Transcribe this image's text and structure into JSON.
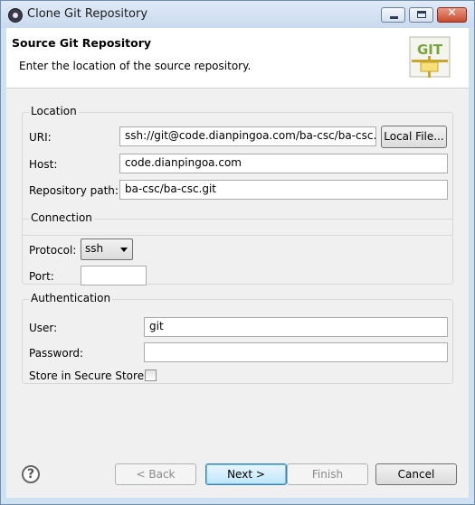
{
  "window": {
    "title": "Clone Git Repository",
    "controls": {
      "minimize": "minimize",
      "maximize": "maximize",
      "close": "close"
    }
  },
  "header": {
    "title": "Source Git Repository",
    "description": "Enter the location of the source repository.",
    "logo_text": "GIT"
  },
  "location": {
    "group_label": "Location",
    "uri_label": "URI:",
    "uri_value": "ssh://git@code.dianpingoa.com/ba-csc/ba-csc.git",
    "local_file_button": "Local File...",
    "host_label": "Host:",
    "host_value": "code.dianpingoa.com",
    "repo_path_label": "Repository path:",
    "repo_path_value": "ba-csc/ba-csc.git"
  },
  "connection": {
    "group_label": "Connection",
    "protocol_label": "Protocol:",
    "protocol_value": "ssh",
    "port_label": "Port:",
    "port_value": ""
  },
  "authentication": {
    "group_label": "Authentication",
    "user_label": "User:",
    "user_value": "git",
    "password_label": "Password:",
    "password_value": "",
    "secure_store_label": "Store in Secure Store",
    "secure_store_checked": false
  },
  "footer": {
    "help_glyph": "?",
    "back_button": "< Back",
    "next_button": "Next >",
    "finish_button": "Finish",
    "cancel_button": "Cancel"
  },
  "colors": {
    "title_bar": "#cfe0f1",
    "close_button": "#c94a2e",
    "default_button": "#3c7fb1"
  },
  "icons": [
    "app-icon",
    "git-logo-icon",
    "help-icon",
    "chevron-down-icon",
    "close-icon"
  ]
}
